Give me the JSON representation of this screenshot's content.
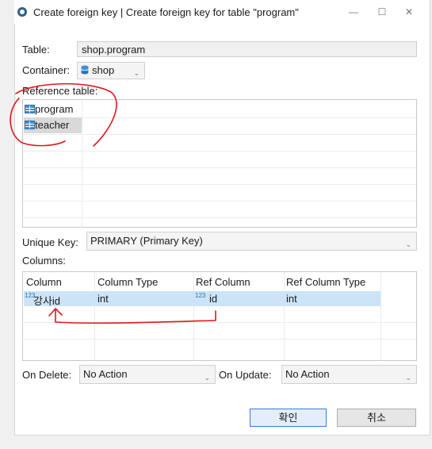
{
  "window": {
    "title": "Create foreign key | Create foreign key for table \"program\"",
    "minimize": "—",
    "maximize": "☐",
    "close": "✕"
  },
  "table": {
    "label": "Table:",
    "value": "shop.program"
  },
  "container": {
    "label": "Container:",
    "value": "shop",
    "icon": "database-icon"
  },
  "reference_table": {
    "label": "Reference table:",
    "items": [
      {
        "name": "program",
        "selected": false
      },
      {
        "name": "teacher",
        "selected": true
      }
    ]
  },
  "unique_key": {
    "label": "Unique Key:",
    "value": "PRIMARY (Primary Key)"
  },
  "columns": {
    "label": "Columns:",
    "headers": [
      "Column",
      "Column Type",
      "Ref Column",
      "Ref Column Type"
    ],
    "rows": [
      {
        "column": "강사id",
        "column_type": "int",
        "ref_column": "id",
        "ref_column_type": "int"
      }
    ]
  },
  "on_delete": {
    "label": "On Delete:",
    "value": "No Action"
  },
  "on_update": {
    "label": "On Update:",
    "value": "No Action"
  },
  "buttons": {
    "ok": "확인",
    "cancel": "취소"
  },
  "colors": {
    "accent": "#3a7bd5",
    "selection": "#cce4f7",
    "annotation": "#e0161b"
  }
}
